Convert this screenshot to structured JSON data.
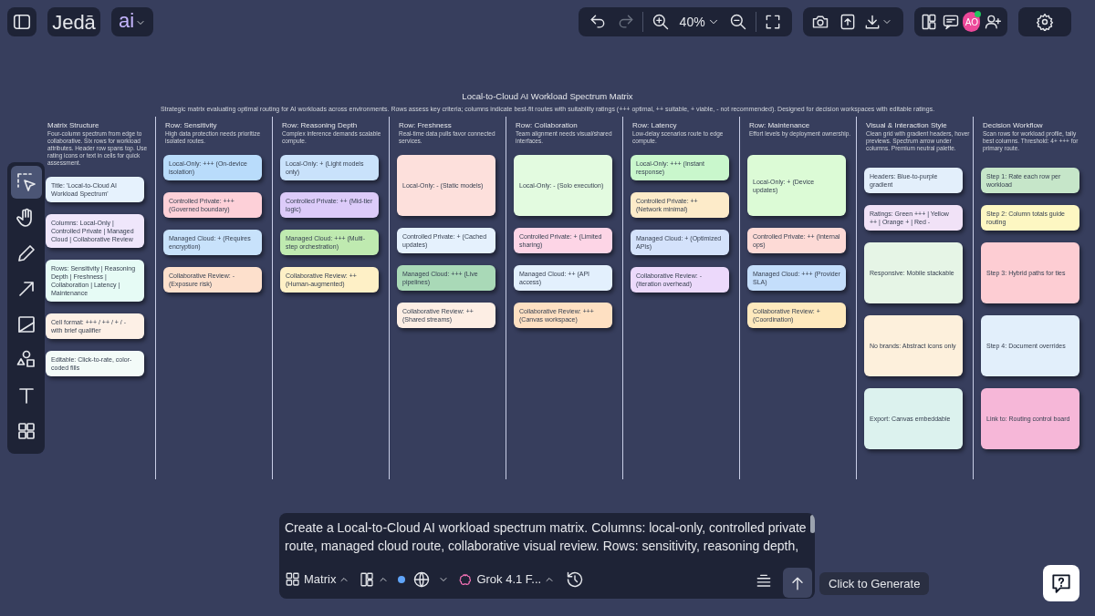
{
  "top_bar": {
    "logo": "Jedā",
    "ai_menu": "ai",
    "zoom": "40%",
    "avatar": "AO",
    "avatar_online": true,
    "history": [
      {
        "kind": "undo",
        "disabled": false
      },
      {
        "kind": "redo",
        "disabled": true
      }
    ]
  },
  "tools": [
    {
      "kind": "select",
      "selected": true
    },
    {
      "kind": "hand",
      "selected": false
    },
    {
      "kind": "pencil",
      "selected": false
    },
    {
      "kind": "arrow",
      "selected": false
    },
    {
      "kind": "image",
      "selected": false
    },
    {
      "kind": "shapes",
      "selected": false
    },
    {
      "kind": "text",
      "selected": false
    },
    {
      "kind": "apps",
      "selected": false
    }
  ],
  "board": {
    "title": "Local-to-Cloud AI Workload Spectrum Matrix",
    "subtitle": "Strategic matrix evaluating optimal routing for AI workloads across environments. Rows assess key criteria; columns indicate best-fit routes with suitability ratings (+++ optimal, ++ suitable, + viable, - not recommended). Designed for decision workspaces with editable ratings.",
    "columns": [
      {
        "heading": "Matrix Structure",
        "description": "Four-column spectrum from edge to collaborative. Six rows for workload attributes. Header row spans top. Use rating icons or text in cells for quick assessment.",
        "cards": [
          {
            "text": "Title: 'Local-to-Cloud AI Workload Spectrum'",
            "color": "#e6f2fd",
            "kind": "short"
          },
          {
            "text": "Columns: Local-Only | Controlled Private | Managed Cloud | Collaborative Review",
            "color": "#efe6fb",
            "kind": "short"
          },
          {
            "text": "Rows: Sensitivity | Reasoning Depth | Freshness | Collaboration | Latency | Maintenance",
            "color": "#e6fbf5",
            "kind": "short"
          },
          {
            "text": "Cell format: +++ / ++ / + / - with brief qualifier",
            "color": "#fdf0e6",
            "kind": "short"
          },
          {
            "text": "Editable: Click-to-rate, color-coded fills",
            "color": "#f3fbf8",
            "kind": "short"
          }
        ]
      },
      {
        "heading": "Row: Sensitivity",
        "description": "High data protection needs prioritize isolated routes.",
        "cards": [
          {
            "text": "Local-Only: +++ (On-device isolation)",
            "color": "#b9dcfb",
            "kind": "short"
          },
          {
            "text": "Controlled Private: +++ (Governed boundary)",
            "color": "#fdd0d8",
            "kind": "short"
          },
          {
            "text": "Managed Cloud: + (Requires encryption)",
            "color": "#c8e2fb",
            "kind": "short"
          },
          {
            "text": "Collaborative Review: - (Exposure risk)",
            "color": "#fde0cc",
            "kind": "short"
          }
        ]
      },
      {
        "heading": "Row: Reasoning Depth",
        "description": "Complex inference demands scalable compute.",
        "cards": [
          {
            "text": "Local-Only: + (Light models only)",
            "color": "#c9e2fb",
            "kind": "short"
          },
          {
            "text": "Controlled Private: ++ (Mid-tier logic)",
            "color": "#dccbf9",
            "kind": "short"
          },
          {
            "text": "Managed Cloud: +++ (Multi-step orchestration)",
            "color": "#bfeab0",
            "kind": "short"
          },
          {
            "text": "Collaborative Review: ++ (Human-augmented)",
            "color": "#fef0c6",
            "kind": "short"
          }
        ]
      },
      {
        "heading": "Row: Freshness",
        "description": "Real-time data pulls favor connected services.",
        "cards": [
          {
            "text": "Local-Only: - (Static models)",
            "color": "#fde0dc",
            "kind": "tall"
          },
          {
            "text": "Controlled Private: + (Cached updates)",
            "color": "#e5f1fd",
            "kind": "short"
          },
          {
            "text": "Managed Cloud: +++ (Live pipelines)",
            "color": "#a9d9b7",
            "kind": "short"
          },
          {
            "text": "Collaborative Review: ++ (Shared streams)",
            "color": "#fdeee4",
            "kind": "short"
          }
        ]
      },
      {
        "heading": "Row: Collaboration",
        "description": "Team alignment needs visual/shared interfaces.",
        "cards": [
          {
            "text": "Local-Only: - (Solo execution)",
            "color": "#e3fbe0",
            "kind": "tall"
          },
          {
            "text": "Controlled Private: + (Limited sharing)",
            "color": "#fdd5e6",
            "kind": "short"
          },
          {
            "text": "Managed Cloud: ++ (API access)",
            "color": "#e3f0fd",
            "kind": "short"
          },
          {
            "text": "Collaborative Review: +++ (Canvas workspace)",
            "color": "#fee0c2",
            "kind": "short"
          }
        ]
      },
      {
        "heading": "Row: Latency",
        "description": "Low-delay scenarios route to edge compute.",
        "cards": [
          {
            "text": "Local-Only: +++ (Instant response)",
            "color": "#c9f7cc",
            "kind": "short"
          },
          {
            "text": "Controlled Private: ++ (Network minimal)",
            "color": "#fdebc9",
            "kind": "short"
          },
          {
            "text": "Managed Cloud: + (Optimized APIs)",
            "color": "#d4e2fb",
            "kind": "short"
          },
          {
            "text": "Collaborative Review: - (Iteration overhead)",
            "color": "#ecd9fb",
            "kind": "short"
          }
        ]
      },
      {
        "heading": "Row: Maintenance",
        "description": "Effort levels by deployment ownership.",
        "cards": [
          {
            "text": "Local-Only: + (Device updates)",
            "color": "#dcfbd6",
            "kind": "tall"
          },
          {
            "text": "Controlled Private: ++ (Internal ops)",
            "color": "#fddad6",
            "kind": "short"
          },
          {
            "text": "Managed Cloud: +++ (Provider SLA)",
            "color": "#c4defb",
            "kind": "short"
          },
          {
            "text": "Collaborative Review: + (Coordination)",
            "color": "#fee9bd",
            "kind": "short"
          }
        ]
      },
      {
        "heading": "Visual & Interaction Style",
        "description": "Clean grid with gradient headers, hover previews. Spectrum arrow under columns. Premium neutral palette.",
        "cards": [
          {
            "text": "Headers: Blue-to-purple gradient",
            "color": "#e3effb",
            "kind": "short"
          },
          {
            "text": "Ratings: Green +++ | Yellow ++ | Orange + | Red -",
            "color": "#f1e2f7",
            "kind": "short"
          },
          {
            "text": "Responsive: Mobile stackable",
            "color": "#e6f5e6",
            "kind": "tall"
          },
          {
            "text": "No brands: Abstract icons only",
            "color": "#fdf0dc",
            "kind": "tall"
          },
          {
            "text": "Export: Canvas embeddable",
            "color": "#dcf2ee",
            "kind": "tall"
          }
        ]
      },
      {
        "heading": "Decision Workflow",
        "description": "Scan rows for workload profile, tally best columns. Threshold: 4+ +++ for primary route.",
        "cards": [
          {
            "text": "Step 1: Rate each row per workload",
            "color": "#c6e6c9",
            "kind": "short"
          },
          {
            "text": "Step 2: Column totals guide routing",
            "color": "#fdf7c2",
            "kind": "short"
          },
          {
            "text": "Step 3: Hybrid paths for ties",
            "color": "#fdcdd3",
            "kind": "tall"
          },
          {
            "text": "Step 4: Document overrides",
            "color": "#e2effb",
            "kind": "tall"
          },
          {
            "text": "Link to: Routing control board",
            "color": "#f6b7d8",
            "kind": "tall"
          }
        ]
      }
    ]
  },
  "prompt": {
    "text": "Create a Local-to-Cloud AI workload spectrum matrix. Columns: local-only, controlled private route, managed cloud route, collaborative visual review. Rows: sensitivity, reasoning depth,"
  },
  "bottom_bar": {
    "mode": "Matrix",
    "model": "Grok 4.1 F...",
    "web_search_on": true,
    "generate_tooltip": "Click to Generate"
  }
}
